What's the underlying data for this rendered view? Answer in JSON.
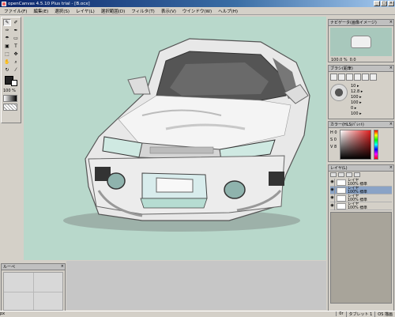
{
  "app": {
    "title": "openCanvas 4.5.10 Plus trial - [B.ocx]",
    "window_buttons": [
      "_",
      "□",
      "×"
    ]
  },
  "menu": [
    "ファイル(F)",
    "編集(E)",
    "選択(S)",
    "レイヤ(L)",
    "選択範囲(D)",
    "フィルタ(T)",
    "表示(V)",
    "ウインドウ(W)",
    "ヘルプ(H)"
  ],
  "toolbox": {
    "tools": [
      {
        "icon": "brush-icon",
        "glyph": "✎"
      },
      {
        "icon": "pen-icon",
        "glyph": "✐"
      },
      {
        "icon": "airbrush-icon",
        "glyph": "✑"
      },
      {
        "icon": "marker-icon",
        "glyph": "✒"
      },
      {
        "icon": "watercolor-icon",
        "glyph": "☂"
      },
      {
        "icon": "eraser-icon",
        "glyph": "▭"
      },
      {
        "icon": "fill-icon",
        "glyph": "▣"
      },
      {
        "icon": "text-icon",
        "glyph": "T"
      },
      {
        "icon": "select-icon",
        "glyph": "⬚"
      },
      {
        "icon": "move-icon",
        "glyph": "✥"
      },
      {
        "icon": "hand-icon",
        "glyph": "✋"
      },
      {
        "icon": "zoom-icon",
        "glyph": "⌕"
      },
      {
        "icon": "rotate-icon",
        "glyph": "↻"
      },
      {
        "icon": "eyedropper-icon",
        "glyph": "⁄"
      }
    ],
    "zoom": "100 %",
    "fg_color": "#222222",
    "bg_color": "#ffffff"
  },
  "panels": {
    "preview": {
      "title": "ナビゲータ(画像イメージ)",
      "zoom": "100.0 %",
      "angle": "0.0"
    },
    "brush": {
      "title": "ブラシ(鉛筆)",
      "props": [
        "10 ▸",
        "12.8 ▸",
        "100 ▸",
        "100 ▸",
        "0 ▸",
        "100 ▸"
      ],
      "size_label": "100 ▸"
    },
    "color": {
      "title": "カラー(HLS/ﾊﾟﾚｯﾄ)",
      "h": "H",
      "s": "S",
      "v": "V",
      "hv": "0",
      "sv": "0",
      "vv": "8"
    },
    "layer": {
      "title": "レイヤ(L)",
      "rows": [
        {
          "name": "レイヤ",
          "mode": "100% 標準",
          "selected": false
        },
        {
          "name": "レイヤ",
          "mode": "100% 標準",
          "selected": true
        },
        {
          "name": "レイヤ",
          "mode": "100% 標準",
          "selected": false
        },
        {
          "name": "レイヤ",
          "mode": "100% 標準",
          "selected": false
        }
      ]
    }
  },
  "navigator": {
    "title": "ルーペ"
  },
  "status": {
    "cells": [
      "0r",
      "タブレット 1",
      "OS 描画"
    ],
    "left": "px"
  },
  "canvas": {
    "bg_color": "#b8d8cb"
  }
}
